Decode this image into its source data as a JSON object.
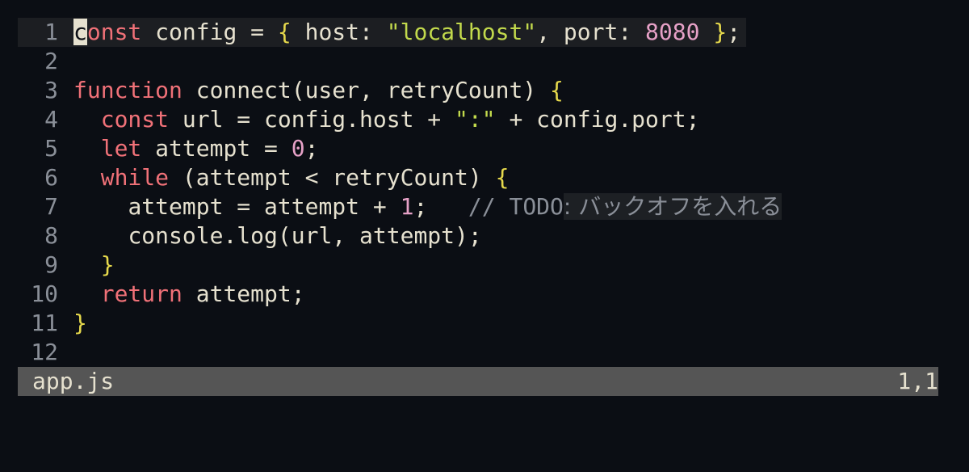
{
  "editor": {
    "lines": [
      {
        "num": "1"
      },
      {
        "num": "2"
      },
      {
        "num": "3"
      },
      {
        "num": "4"
      },
      {
        "num": "5"
      },
      {
        "num": "6"
      },
      {
        "num": "7"
      },
      {
        "num": "8"
      },
      {
        "num": "9"
      },
      {
        "num": "10"
      },
      {
        "num": "11"
      },
      {
        "num": "12"
      }
    ],
    "code": {
      "l1": {
        "c": "c",
        "onst": "onst",
        "config": " config = ",
        "lb": "{",
        "host": " host: ",
        "hostval": "\"localhost\"",
        "port": ", port: ",
        "portval": "8080",
        "rb": " }",
        "semi": ";"
      },
      "l3": {
        "function": "function",
        "connect": " connect(user, retryCount) ",
        "lb": "{"
      },
      "l4": {
        "const": "const",
        "url": " url = config.host + ",
        "colon": "\":\"",
        "rest": " + config.port;"
      },
      "l5": {
        "let": "let",
        "attempt": " attempt = ",
        "zero": "0",
        "semi": ";"
      },
      "l6": {
        "while": "while",
        "cond": " (attempt < retryCount) ",
        "lb": "{"
      },
      "l7": {
        "attempt": "attempt = attempt + ",
        "one": "1",
        "semi": ";   ",
        "comment": "// TODO",
        "ja": ": バックオフを入れる"
      },
      "l8": {
        "log": "console.log(url, attempt);"
      },
      "l9": {
        "rb": "}"
      },
      "l10": {
        "return": "return",
        "rest": " attempt;"
      },
      "l11": {
        "rb": "}"
      }
    }
  },
  "statusbar": {
    "filename": "app.js",
    "position": "1,1"
  },
  "colors": {
    "background": "#0b0e14",
    "keyword": "#f07178",
    "string": "#c2d94c",
    "number": "#e6a1c7",
    "bracket": "#e6d94c",
    "statusbar": "#555555"
  }
}
